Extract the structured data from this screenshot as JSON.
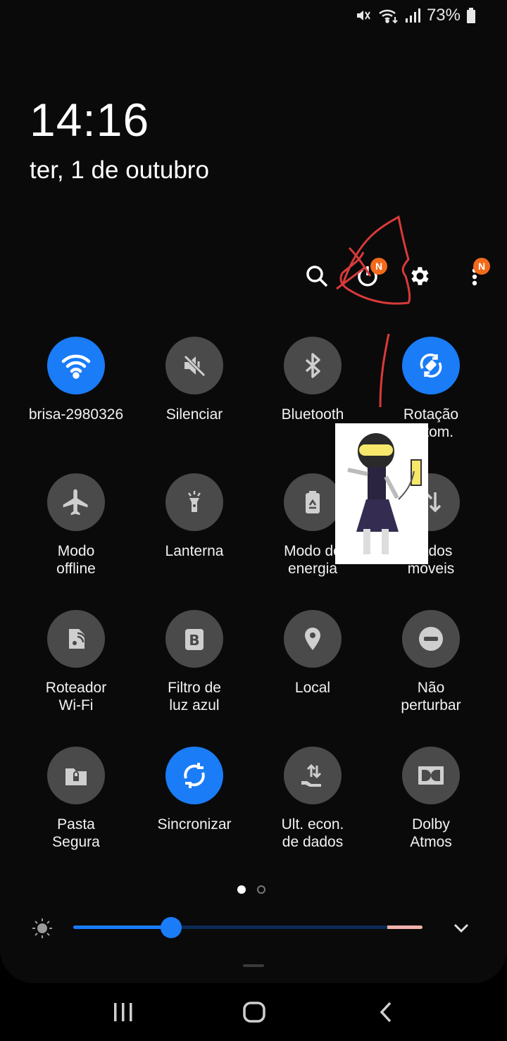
{
  "status": {
    "battery_percent": "73%"
  },
  "lockscreen": {
    "time": "14:16",
    "date": "ter, 1 de outubro"
  },
  "actions": {
    "power_badge": "N",
    "more_badge": "N"
  },
  "tiles": [
    {
      "label": "brisa-2980326",
      "icon": "wifi-icon",
      "on": true
    },
    {
      "label": "Silenciar",
      "icon": "mute-icon",
      "on": false
    },
    {
      "label": "Bluetooth",
      "icon": "bluetooth-icon",
      "on": false
    },
    {
      "label": "Rotação\nautom.",
      "icon": "rotation-icon",
      "on": true
    },
    {
      "label": "Modo\noffline",
      "icon": "airplane-icon",
      "on": false
    },
    {
      "label": "Lanterna",
      "icon": "flashlight-icon",
      "on": false
    },
    {
      "label": "Modo de\nenergia",
      "icon": "battery-recycle-icon",
      "on": false
    },
    {
      "label": "Dados\nmóveis",
      "icon": "mobile-data-icon",
      "on": false
    },
    {
      "label": "Roteador\nWi-Fi",
      "icon": "hotspot-icon",
      "on": false
    },
    {
      "label": "Filtro de\nluz azul",
      "icon": "blue-light-icon",
      "on": false
    },
    {
      "label": "Local",
      "icon": "location-icon",
      "on": false
    },
    {
      "label": "Não\nperturbar",
      "icon": "dnd-icon",
      "on": false
    },
    {
      "label": "Pasta\nSegura",
      "icon": "secure-folder-icon",
      "on": false
    },
    {
      "label": "Sincronizar",
      "icon": "sync-icon",
      "on": true
    },
    {
      "label": "Ult. econ.\nde dados",
      "icon": "data-saver-icon",
      "on": false
    },
    {
      "label": "Dolby\nAtmos",
      "icon": "dolby-icon",
      "on": false
    }
  ],
  "pager": {
    "pages": 2,
    "current": 1
  },
  "brightness": {
    "level": 0.28,
    "colors": {
      "accent": "#1a7cf7"
    }
  }
}
